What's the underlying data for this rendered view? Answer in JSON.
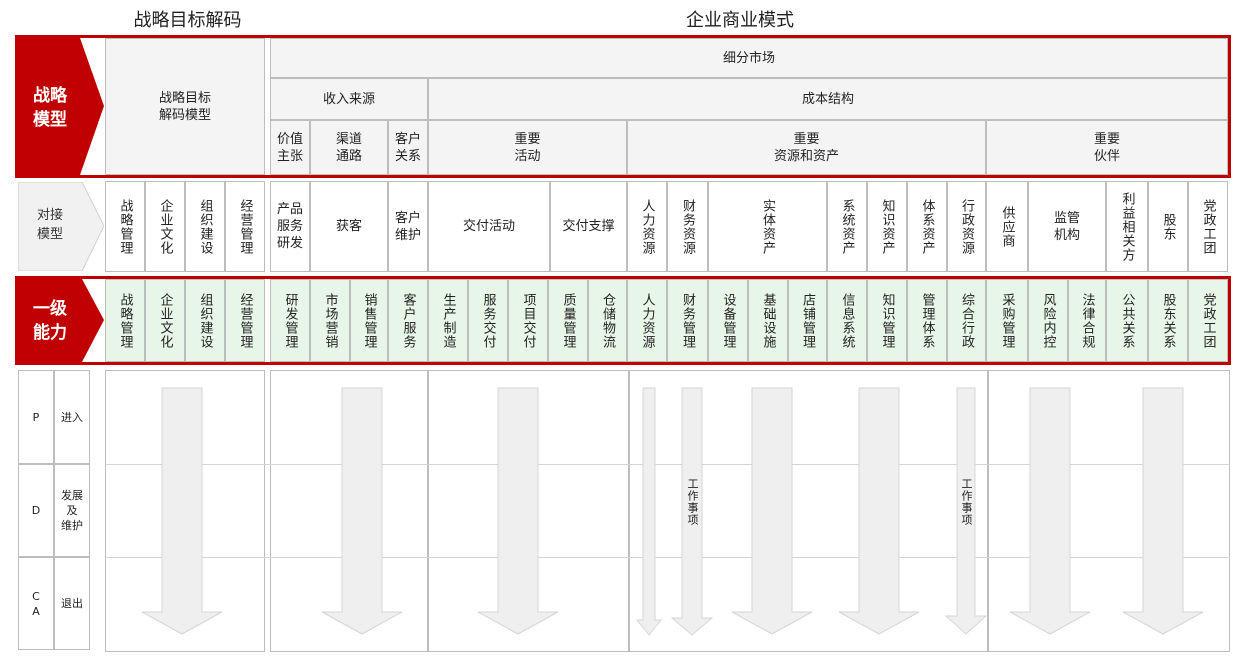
{
  "headers": {
    "left_title": "战略目标解码",
    "right_title": "企业商业模式"
  },
  "strategy_row": {
    "label": "战略\n模型",
    "decode_model": "战略目标\n解码模型",
    "segment_market": "细分市场",
    "revenue_source": "收入来源",
    "cost_structure": "成本结构",
    "value_prop": "价值\n主张",
    "channel": "渠道\n通路",
    "customer_rel": "客户\n关系",
    "key_activities": "重要\n活动",
    "key_resources": "重要\n资源和资产",
    "key_partners": "重要\n伙伴"
  },
  "interface_row": {
    "label": "对接\n模型",
    "cells": [
      "战略管理",
      "企业文化",
      "组织建设",
      "经营管理",
      "产品\n服务\n研发",
      "获客",
      "客户\n维护",
      "交付活动",
      "交付支撑",
      "人力资源",
      "财务资源",
      "实体资产",
      "系统资产",
      "知识资产",
      "体系资产",
      "行政资源",
      "供应商",
      "监管\n机构",
      "利益相关方",
      "股东",
      "党政工团"
    ]
  },
  "level1_row": {
    "label": "一级\n能力",
    "cells": [
      "战略管理",
      "企业文化",
      "组织建设",
      "经营管理",
      "研发管理",
      "市场营销",
      "销售管理",
      "客户服务",
      "生产制造",
      "服务交付",
      "项目交付",
      "质量管理",
      "仓储物流",
      "人力资源",
      "财务管理",
      "设备管理",
      "基础设施",
      "店铺管理",
      "信息系统",
      "知识管理",
      "管理体系",
      "综合行政",
      "采购管理",
      "风险内控",
      "法律合规",
      "公共关系",
      "股东关系",
      "党政工团"
    ]
  },
  "pdca": {
    "rows": [
      {
        "code": "P",
        "label": "进入"
      },
      {
        "code": "D",
        "label": "发展\n及\n维护"
      },
      {
        "code": "C\nA",
        "label": "退出"
      }
    ],
    "work_item": "工作事项"
  }
}
